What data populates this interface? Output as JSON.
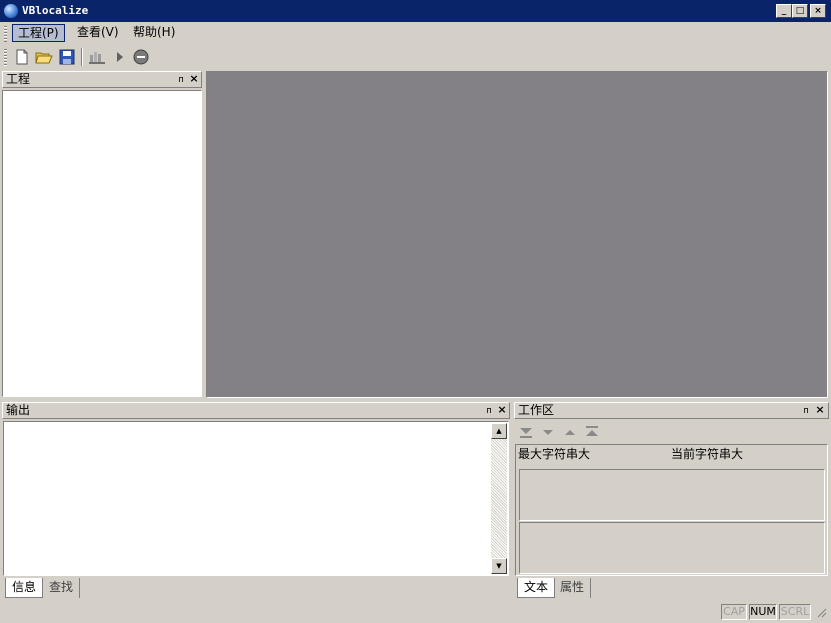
{
  "window": {
    "title": "VBlocalize",
    "min": "_",
    "max": "□",
    "close": "×"
  },
  "menu": [
    {
      "label": "工程(P)"
    },
    {
      "label": "查看(V)"
    },
    {
      "label": "帮助(H)"
    }
  ],
  "toolbar": {
    "icons": [
      "new-file-icon",
      "open-folder-icon",
      "save-icon",
      "build-icon",
      "run-icon",
      "stop-icon"
    ]
  },
  "project_panel": {
    "title": "工程",
    "pin": "ᴨ",
    "close": "×"
  },
  "output_panel": {
    "title": "输出",
    "pin": "ᴨ",
    "close": "×",
    "tabs": [
      "信息",
      "查找"
    ],
    "scroll_up": "▲",
    "scroll_down": "▼"
  },
  "workspace_panel": {
    "title": "工作区",
    "pin": "ᴨ",
    "close": "×",
    "nav_icons": [
      "move-to-last-icon",
      "move-down-icon",
      "move-up-icon",
      "move-to-first-icon"
    ],
    "col_max": "最大字符串大",
    "col_current": "当前字符串大",
    "tabs": [
      "文本",
      "属性"
    ]
  },
  "status": {
    "cap": "CAP",
    "num": "NUM",
    "scrl": "SCRL"
  },
  "colors": {
    "titlebar": "#0a246a",
    "mdi_background": "#808080",
    "face": "#d4d0c8"
  }
}
